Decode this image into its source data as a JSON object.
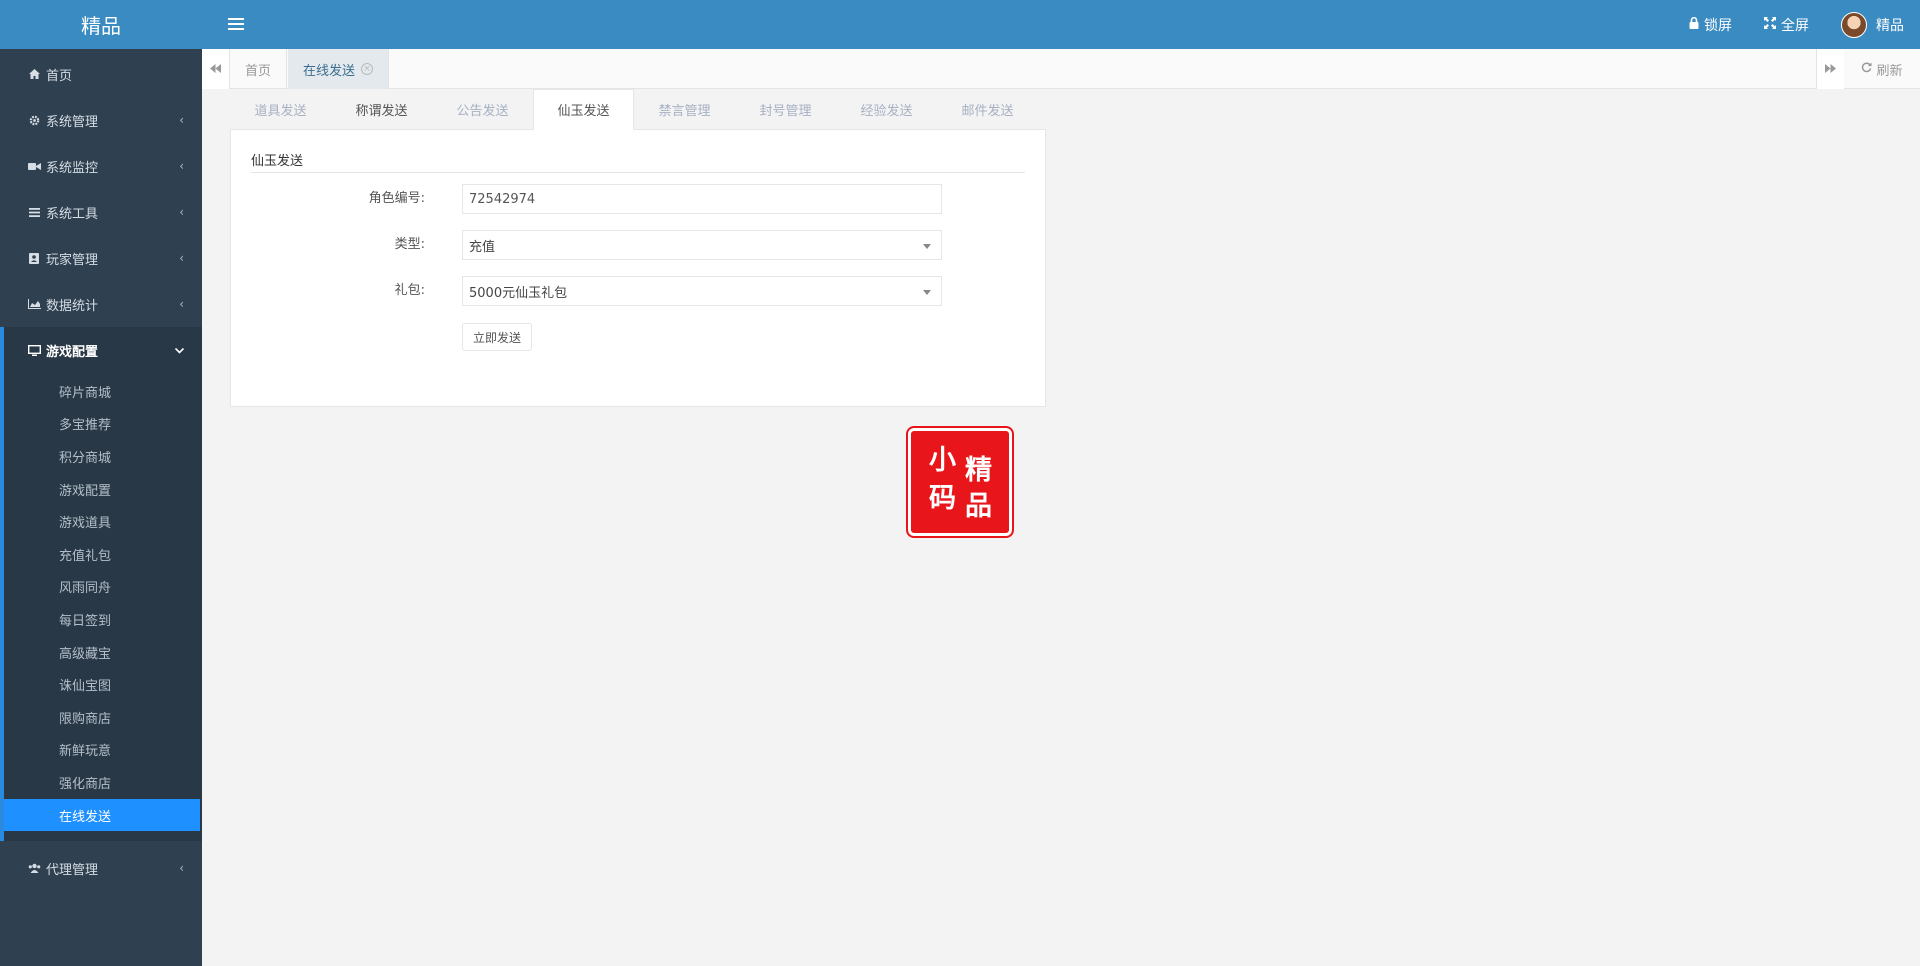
{
  "brand": "精品",
  "sidebar": {
    "items": [
      {
        "label": "首页",
        "icon": "home-icon"
      },
      {
        "label": "系统管理",
        "icon": "gear-icon"
      },
      {
        "label": "系统监控",
        "icon": "video-camera-icon"
      },
      {
        "label": "系统工具",
        "icon": "bars-icon"
      },
      {
        "label": "玩家管理",
        "icon": "address-book-icon"
      },
      {
        "label": "数据统计",
        "icon": "area-chart-icon"
      }
    ],
    "open_group": {
      "label": "游戏配置",
      "icon": "desktop-icon",
      "children": [
        "碎片商城",
        "多宝推荐",
        "积分商城",
        "游戏配置",
        "游戏道具",
        "充值礼包",
        "风雨同舟",
        "每日签到",
        "高级藏宝",
        "诛仙宝图",
        "限购商店",
        "新鲜玩意",
        "强化商店",
        "在线发送"
      ],
      "active_child": "在线发送"
    },
    "tail_items": [
      {
        "label": "代理管理",
        "icon": "users-icon"
      }
    ]
  },
  "header": {
    "lock_label": "锁屏",
    "fullscreen_label": "全屏",
    "user_name": "精品"
  },
  "tabstrip": {
    "home_label": "首页",
    "current_label": "在线发送",
    "refresh_label": "刷新"
  },
  "content_tabs": [
    "道具发送",
    "称谓发送",
    "公告发送",
    "仙玉发送",
    "禁言管理",
    "封号管理",
    "经验发送",
    "邮件发送"
  ],
  "active_content_tab": "仙玉发送",
  "form": {
    "title": "仙玉发送",
    "role_id_label": "角色编号:",
    "role_id_value": "72542974",
    "type_label": "类型:",
    "type_value": "充值",
    "package_label": "礼包:",
    "package_value": "5000元仙玉礼包",
    "send_label": "立即发送"
  },
  "seal": {
    "chars": [
      "小",
      "码",
      "精",
      "品"
    ],
    "color": "#e8161a"
  },
  "colors": {
    "header": "#3a8bc2",
    "sidebar": "#2f4050",
    "active": "#1e90ff"
  }
}
